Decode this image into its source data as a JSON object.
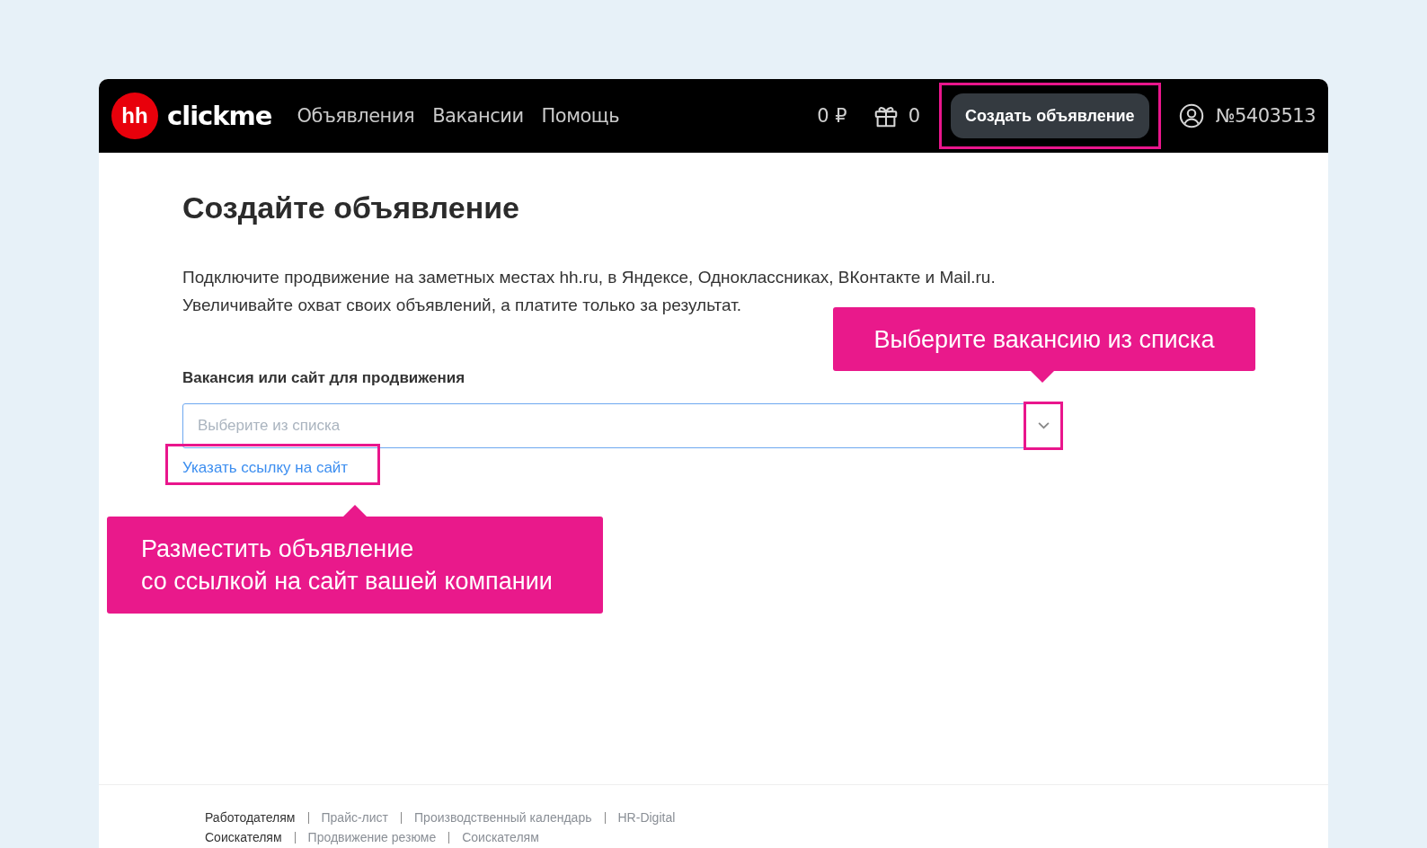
{
  "header": {
    "logo_badge": "hh",
    "logo_text": "clickme",
    "nav": [
      {
        "label": "Объявления"
      },
      {
        "label": "Вакансии"
      },
      {
        "label": "Помощь"
      }
    ],
    "balance": "0 ₽",
    "gifts": "0",
    "create_button": "Создать объявление",
    "account": "№5403513"
  },
  "page": {
    "title": "Создайте объявление",
    "intro_lines": [
      "Подключите продвижение на заметных местах hh.ru, в Яндексе, Одноклассниках, ВКонтакте и Mail.ru.",
      "Увеличивайте охват своих объявлений, а платите только за результат."
    ],
    "field_label": "Вакансия или сайт для продвижения",
    "select": {
      "placeholder": "Выберите из списка"
    },
    "site_link": "Указать ссылку на сайт"
  },
  "callouts": [
    {
      "kind": "select",
      "text": "Выберите вакансию из списка"
    },
    {
      "kind": "link",
      "lines": [
        "Разместить объявление",
        "со ссылкой на сайт вашей компании"
      ]
    }
  ],
  "footer": {
    "rows": [
      {
        "items": [
          {
            "label": "Работодателям",
            "kind": "heading"
          },
          {
            "label": "Прайс-лист",
            "kind": "link"
          },
          {
            "label": "Производственный календарь",
            "kind": "link"
          },
          {
            "label": "HR-Digital",
            "kind": "link"
          }
        ]
      },
      {
        "items": [
          {
            "label": "Соискателям",
            "kind": "heading"
          },
          {
            "label": "Продвижение резюме",
            "kind": "link"
          },
          {
            "label": "Соискателям",
            "kind": "link"
          }
        ]
      }
    ]
  }
}
